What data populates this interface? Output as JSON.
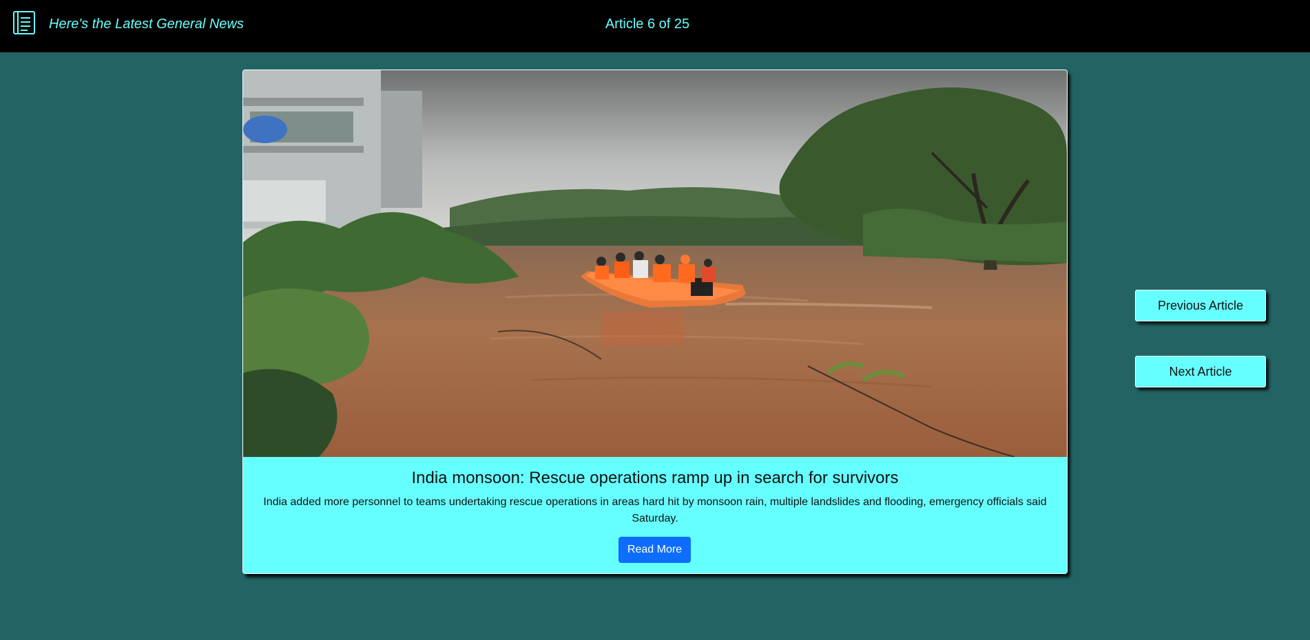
{
  "header": {
    "title": "Here's the Latest General News",
    "counter": "Article 6 of 25",
    "logo_icon": "document-list-icon"
  },
  "article": {
    "headline": "India monsoon: Rescue operations ramp up in search for survivors",
    "description": "India added more personnel to teams undertaking rescue operations in areas hard hit by monsoon rain, multiple landslides and flooding, emergency officials said Saturday.",
    "read_more_label": "Read More"
  },
  "navigation": {
    "previous_label": "Previous Article",
    "next_label": "Next Article"
  },
  "colors": {
    "page_background": "#226464",
    "header_background": "#000000",
    "accent": "#66ffff",
    "primary_button": "#0d6efd"
  }
}
